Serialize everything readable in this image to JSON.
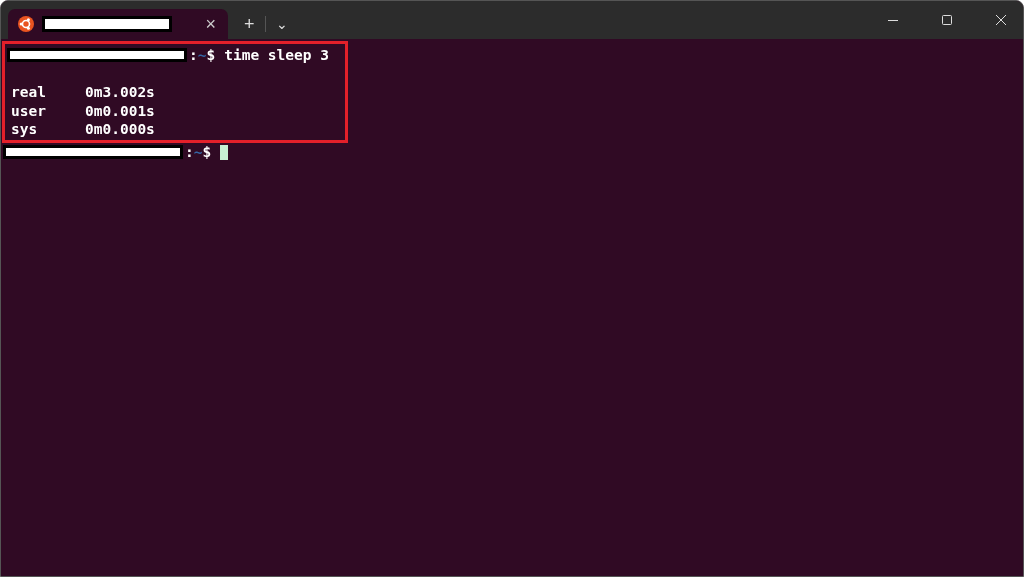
{
  "tab": {
    "title_redacted": true,
    "close": "×",
    "selected": true
  },
  "new_tab": "+",
  "dropdown": "⌄",
  "lines": [
    {
      "kind": "prompt",
      "sep": ":",
      "dir": "~",
      "sigil": "$",
      "command": "time sleep 3",
      "highlighted": true
    },
    {
      "kind": "blank",
      "highlighted": true
    },
    {
      "kind": "output",
      "label": "real",
      "value": "0m3.002s",
      "highlighted": true
    },
    {
      "kind": "output",
      "label": "user",
      "value": "0m0.001s",
      "highlighted": true
    },
    {
      "kind": "output",
      "label": "sys",
      "value": "0m0.000s",
      "highlighted": true
    },
    {
      "kind": "prompt",
      "sep": ":",
      "dir": "~",
      "sigil": "$",
      "cursor": true,
      "highlighted": false
    }
  ]
}
